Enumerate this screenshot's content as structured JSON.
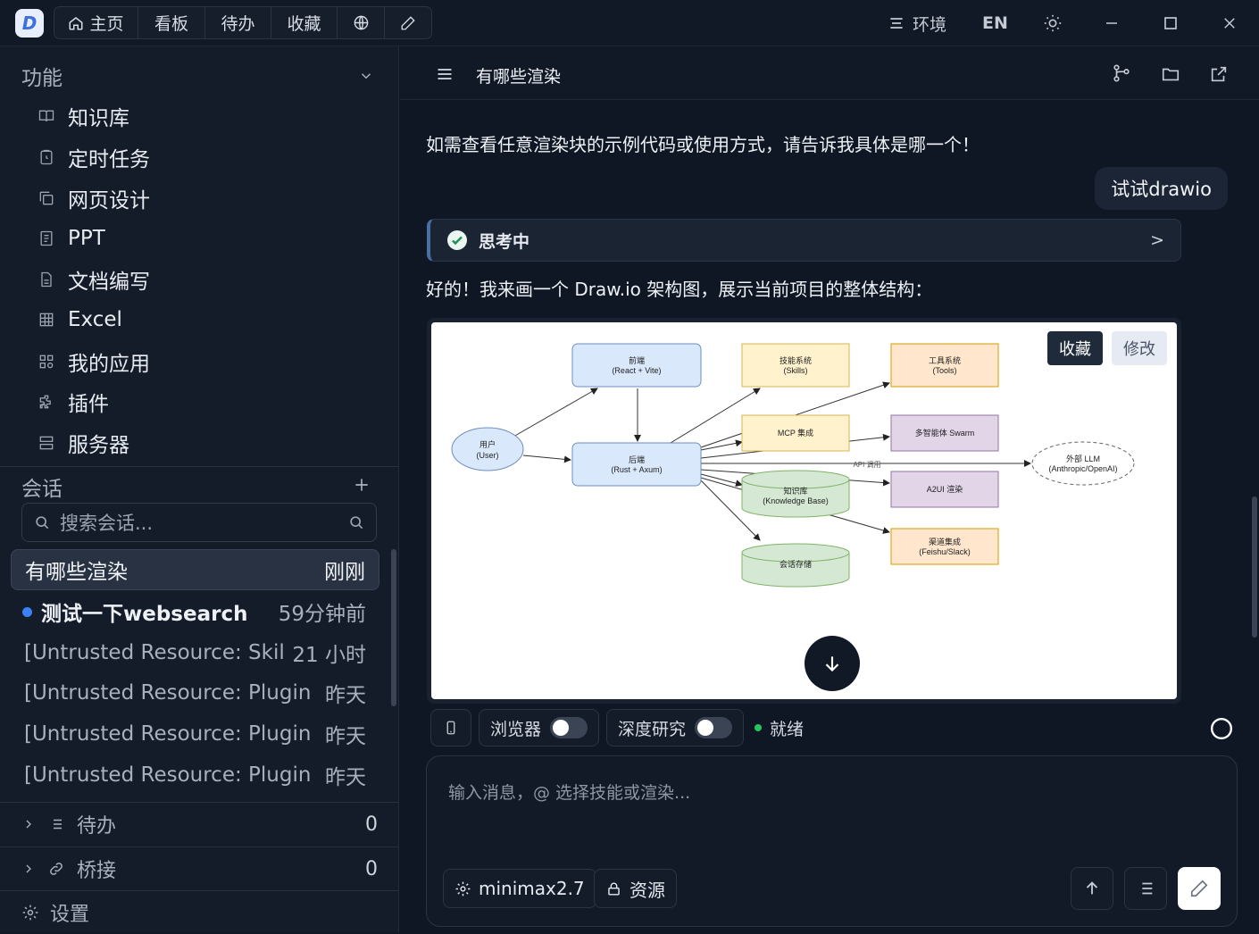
{
  "topbar": {
    "logo": "D",
    "tabs": [
      "主页",
      "看板",
      "待办",
      "收藏"
    ],
    "env_label": "环境",
    "lang_label": "EN"
  },
  "sidebar": {
    "features_title": "功能",
    "nav_items": [
      {
        "label": "知识库",
        "icon": "book-icon"
      },
      {
        "label": "定时任务",
        "icon": "clipboard-clock-icon"
      },
      {
        "label": "网页设计",
        "icon": "copy-pages-icon"
      },
      {
        "label": "PPT",
        "icon": "slides-icon"
      },
      {
        "label": "文档编写",
        "icon": "document-icon"
      },
      {
        "label": "Excel",
        "icon": "grid-icon"
      },
      {
        "label": "我的应用",
        "icon": "apps-icon"
      },
      {
        "label": "插件",
        "icon": "puzzle-icon"
      },
      {
        "label": "服务器",
        "icon": "server-icon"
      }
    ],
    "sessions_title": "会话",
    "search_placeholder": "搜索会话...",
    "sessions": [
      {
        "name": "有哪些渲染",
        "time": "刚刚"
      },
      {
        "name": "测试一下websearch",
        "time": "59分钟前"
      },
      {
        "name": "[Untrusted Resource: Skill...",
        "time": "21 小时"
      },
      {
        "name": "[Untrusted Resource: Plugin ...",
        "time": "昨天"
      },
      {
        "name": "[Untrusted Resource: Plugin ...",
        "time": "昨天"
      },
      {
        "name": "[Untrusted Resource: Plugin ...",
        "time": "昨天"
      }
    ],
    "todo": {
      "label": "待办",
      "count": "0"
    },
    "bridge": {
      "label": "桥接",
      "count": "0"
    },
    "settings_label": "设置"
  },
  "chat": {
    "title": "有哪些渲染",
    "assistant_msg_1": "如需查看任意渲染块的示例代码或使用方式，请告诉我具体是哪一个！",
    "user_msg": "试试drawio",
    "thinking_label": "思考中",
    "thinking_chevron": ">",
    "assistant_msg_2": "好的！我来画一个 Draw.io 架构图，展示当前项目的整体结构：",
    "diagram": {
      "fav_button": "收藏",
      "edit_button": "修改",
      "nodes": {
        "user": [
          "用户",
          "(User)"
        ],
        "frontend": [
          "前端",
          "(React + Vite)"
        ],
        "backend": [
          "后端",
          "(Rust + Axum)"
        ],
        "skills": [
          "技能系统",
          "(Skills)"
        ],
        "tools": [
          "工具系统",
          "(Tools)"
        ],
        "mcp": [
          "MCP 集成"
        ],
        "swarm": [
          "多智能体 Swarm"
        ],
        "kb": [
          "知识库",
          "(Knowledge Base)"
        ],
        "llm": [
          "外部 LLM",
          "(Anthropic/OpenAI)"
        ],
        "a2ui": [
          "A2UI 渲染"
        ],
        "channel": [
          "渠道集成",
          "(Feishu/Slack)"
        ],
        "store": [
          "会话存储"
        ]
      },
      "api_label": "API 调用"
    }
  },
  "composer": {
    "browser_label": "浏览器",
    "research_label": "深度研究",
    "status_label": "就绪",
    "placeholder": "输入消息，@ 选择技能或渲染...",
    "model_label": "minimax2.7",
    "resource_label": "资源"
  },
  "colors": {
    "accent": "#3b82f6",
    "status_ok": "#22c55e",
    "thinking_check": "#34d399"
  }
}
